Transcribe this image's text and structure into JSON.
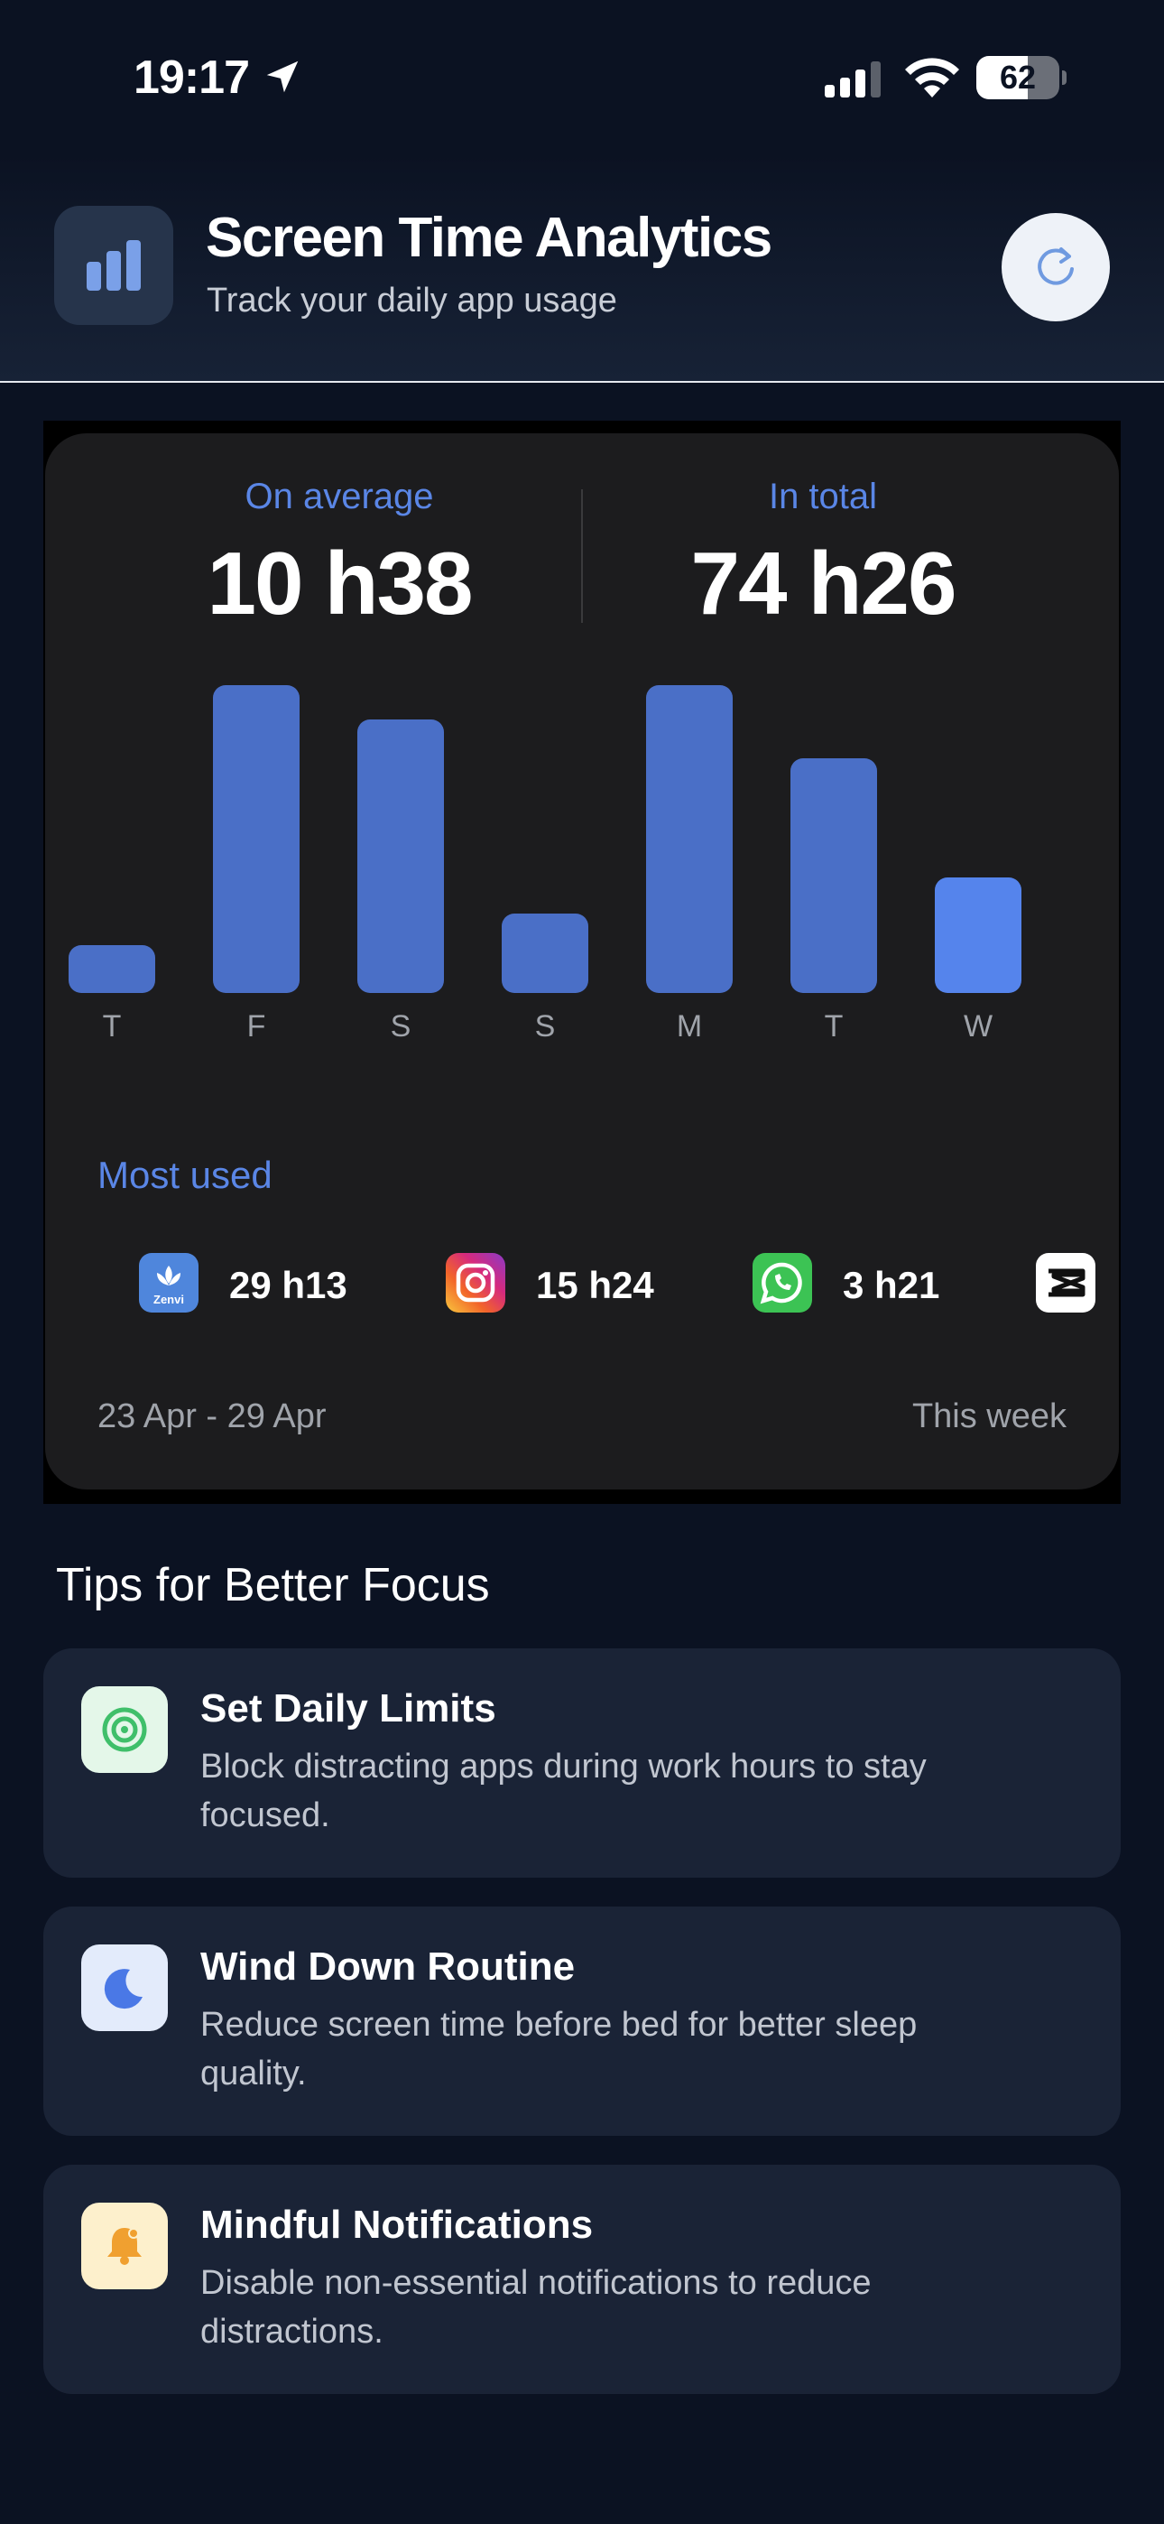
{
  "status_bar": {
    "time": "19:17",
    "battery": "62",
    "battery_level": 0.62
  },
  "header": {
    "title": "Screen Time Analytics",
    "subtitle": "Track your daily app usage",
    "icon": "bar-chart-icon",
    "refresh_icon": "refresh-icon"
  },
  "summary": {
    "average_label": "On average",
    "average_value": "10 h38",
    "total_label": "In total",
    "total_value": "74 h26"
  },
  "chart_data": {
    "type": "bar",
    "categories": [
      "T",
      "F",
      "S",
      "S",
      "M",
      "T",
      "W"
    ],
    "values": [
      1.7,
      10.9,
      9.7,
      2.8,
      10.9,
      8.3,
      4.1
    ],
    "ylim": [
      0,
      11
    ],
    "highlight_index": 6,
    "colors": {
      "bar": "#4a6fc7",
      "highlight": "#5584ec"
    }
  },
  "most_used": {
    "label": "Most used",
    "apps": [
      {
        "icon": "zenvi-app-icon",
        "icon_text": "Zenvi",
        "time": "29 h13"
      },
      {
        "icon": "instagram-app-icon",
        "time": "15 h24"
      },
      {
        "icon": "whatsapp-app-icon",
        "time": "3 h21"
      },
      {
        "icon": "capcut-app-icon",
        "time": ""
      }
    ]
  },
  "footer": {
    "range": "23 Apr - 29 Apr",
    "period": "This week"
  },
  "tips": {
    "title": "Tips for Better Focus",
    "items": [
      {
        "icon": "target-icon",
        "title": "Set Daily Limits",
        "description": "Block distracting apps during work hours to stay focused.",
        "color": "#3fbf6a"
      },
      {
        "icon": "moon-icon",
        "title": "Wind Down Routine",
        "description": "Reduce screen time before bed for better sleep quality.",
        "color": "#4a78e6"
      },
      {
        "icon": "bell-icon",
        "title": "Mindful Notifications",
        "description": "Disable non-essential notifications to reduce distractions.",
        "color": "#f0a030"
      }
    ]
  }
}
